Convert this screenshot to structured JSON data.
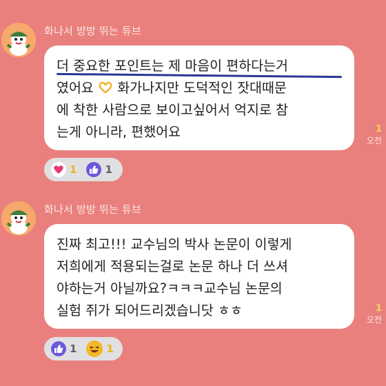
{
  "messages": [
    {
      "sender": "화나서 방방 뛰는 튜브",
      "lines": [
        "더 중요한 포인트는 제 마음이 편하다는거",
        "였어요",
        "화가나지만 도덕적인 잣대때문",
        "에 착한 사람으로 보이고싶어서 억지로 참",
        "는게 아니라, 편했어요"
      ],
      "unread": "1",
      "time": "오전",
      "reactions": [
        {
          "icon": "heart-icon",
          "count": "1",
          "color": "#e83b6c"
        },
        {
          "icon": "thumbs-up-icon",
          "count": "1",
          "color": "#6a5ad9"
        }
      ]
    },
    {
      "sender": "화나서 방방 뛰는 튜브",
      "lines": [
        "진짜 최고!!! 교수님의 박사 논문이 이렇게",
        "저희에게 적용되는걸로 논문 하나 더 쓰셔",
        "야하는거 아닐까요?ㅋㅋㅋ교수님 논문의",
        "실험 쥐가 되어드리겠습니닷 ㅎㅎ"
      ],
      "unread": "1",
      "time": "오전",
      "reactions": [
        {
          "icon": "thumbs-up-icon",
          "count": "1",
          "color": "#6a5ad9"
        },
        {
          "icon": "laughing-emoji-icon",
          "count": "1",
          "color": "#f5b728"
        }
      ]
    }
  ]
}
